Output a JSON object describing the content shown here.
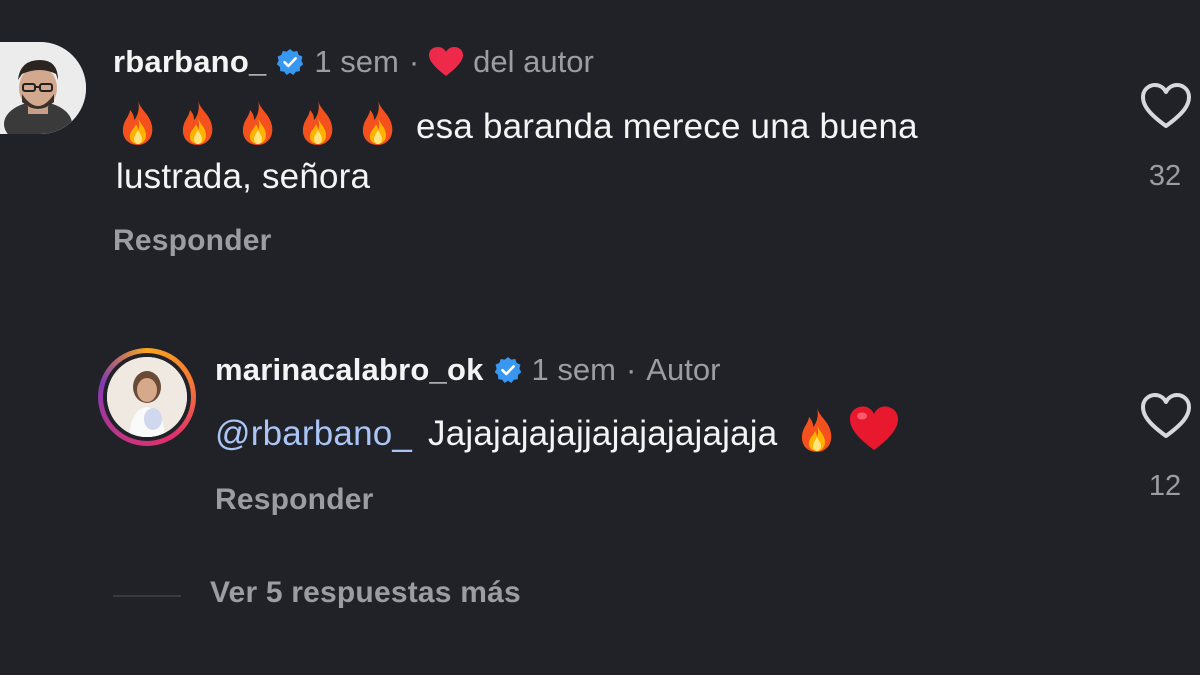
{
  "comment": {
    "username": "rbarbano_",
    "verified": true,
    "time": "1 sem",
    "separator": "·",
    "author_like_label": "del autor",
    "emojis": [
      "fire",
      "fire",
      "fire",
      "fire",
      "fire"
    ],
    "text_line1": "esa baranda merece una buena",
    "text_line2": "lustrada, señora",
    "reply_label": "Responder",
    "like_count": "32"
  },
  "reply": {
    "username": "marinacalabro_ok",
    "verified": true,
    "time": "1 sem",
    "separator": "·",
    "author_label": "Autor",
    "mention": "@rbarbano_",
    "text": "Jajajajajajjajajajajajaja",
    "emojis": [
      "fire",
      "red-heart"
    ],
    "reply_label": "Responder",
    "like_count": "12"
  },
  "more_replies": {
    "label": "Ver 5 respuestas más"
  },
  "colors": {
    "background": "#212228",
    "verified_blue": "#3897f0",
    "mention": "#a9c4f5",
    "muted": "#9c9da3",
    "heart_red": "#ed2a4a"
  }
}
